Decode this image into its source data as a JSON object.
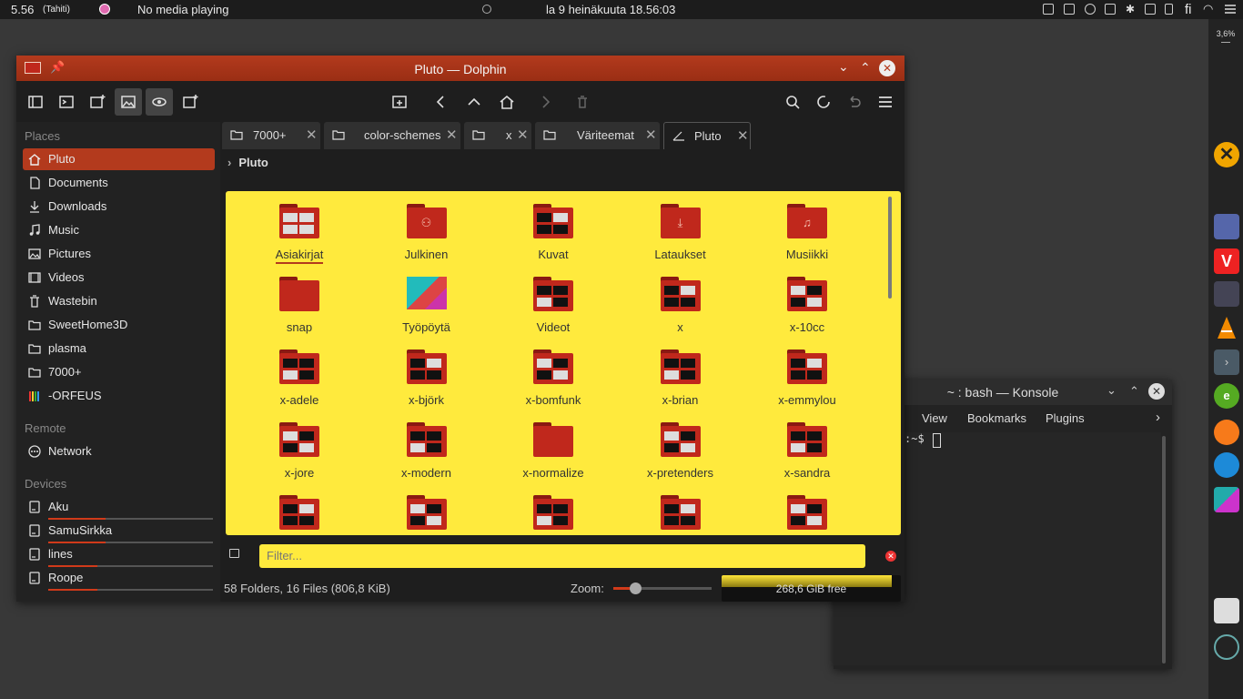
{
  "top_panel": {
    "clock_small": "5.56",
    "timezone": "(Tahiti)",
    "media": "No media playing",
    "datetime": "la 9 heinäkuuta 18.56:03",
    "keyboard_layout": "fi"
  },
  "dock": {
    "cpu": "3,6%"
  },
  "dolphin": {
    "title": "Pluto — Dolphin",
    "sidebar": {
      "places_header": "Places",
      "places": [
        {
          "label": "Pluto"
        },
        {
          "label": "Documents"
        },
        {
          "label": "Downloads"
        },
        {
          "label": "Music"
        },
        {
          "label": "Pictures"
        },
        {
          "label": "Videos"
        },
        {
          "label": "Wastebin"
        },
        {
          "label": "SweetHome3D"
        },
        {
          "label": "plasma"
        },
        {
          "label": "7000+"
        },
        {
          "label": "-ORFEUS"
        }
      ],
      "remote_header": "Remote",
      "remote": [
        {
          "label": "Network"
        }
      ],
      "devices_header": "Devices",
      "devices": [
        {
          "label": "Aku",
          "usage": 0.35
        },
        {
          "label": "SamuSirkka",
          "usage": 0.35
        },
        {
          "label": "lines",
          "usage": 0.3
        },
        {
          "label": "Roope",
          "usage": 0.3
        }
      ]
    },
    "tabs": [
      {
        "label": "7000+"
      },
      {
        "label": "color-schemes"
      },
      {
        "label": "x"
      },
      {
        "label": "Väriteemat"
      },
      {
        "label": "Pluto"
      }
    ],
    "breadcrumb": "Pluto",
    "items": [
      {
        "name": "Asiakirjat",
        "kind": "thumb-doc"
      },
      {
        "name": "Julkinen",
        "kind": "sym",
        "sym": "⚇"
      },
      {
        "name": "Kuvat",
        "kind": "thumb"
      },
      {
        "name": "Lataukset",
        "kind": "sym",
        "sym": "⤓"
      },
      {
        "name": "Musiikki",
        "kind": "sym",
        "sym": "♫"
      },
      {
        "name": "snap",
        "kind": "plain"
      },
      {
        "name": "Työpöytä",
        "kind": "desktop"
      },
      {
        "name": "Videot",
        "kind": "thumb"
      },
      {
        "name": "x",
        "kind": "thumb"
      },
      {
        "name": "x-10cc",
        "kind": "thumb"
      },
      {
        "name": "x-adele",
        "kind": "thumb"
      },
      {
        "name": "x-björk",
        "kind": "thumb"
      },
      {
        "name": "x-bomfunk",
        "kind": "thumb"
      },
      {
        "name": "x-brian",
        "kind": "thumb"
      },
      {
        "name": "x-emmylou",
        "kind": "thumb"
      },
      {
        "name": "x-jore",
        "kind": "thumb"
      },
      {
        "name": "x-modern",
        "kind": "thumb"
      },
      {
        "name": "x-normalize",
        "kind": "plain"
      },
      {
        "name": "x-pretenders",
        "kind": "thumb"
      },
      {
        "name": "x-sandra",
        "kind": "thumb"
      },
      {
        "name": "",
        "kind": "thumb"
      },
      {
        "name": "",
        "kind": "thumb"
      },
      {
        "name": "",
        "kind": "thumb"
      },
      {
        "name": "",
        "kind": "thumb"
      },
      {
        "name": "",
        "kind": "thumb"
      }
    ],
    "filter_placeholder": "Filter...",
    "status_text": "58 Folders, 16 Files (806,8 KiB)",
    "zoom_label": "Zoom:",
    "zoom_level": 0.22,
    "free_space": "268,6 GiB free",
    "disk_usage": 0.95
  },
  "konsole": {
    "title": "~ : bash — Konsole",
    "menu": [
      "View",
      "Bookmarks",
      "Plugins"
    ],
    "prompt": ":~$"
  },
  "colors": {
    "accent": "#b33a1d",
    "view_bg": "#ffea3d"
  }
}
